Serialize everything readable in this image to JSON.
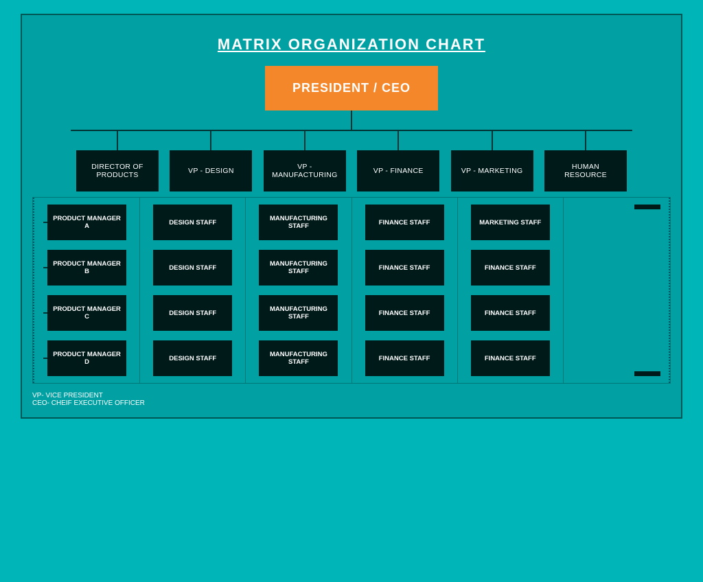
{
  "title": "MATRIX ORGANIZATION CHART",
  "ceo": {
    "label": "PRESIDENT / CEO"
  },
  "vps": [
    {
      "id": "dir-products",
      "label": "DIRECTOR OF PRODUCTS"
    },
    {
      "id": "vp-design",
      "label": "VP - DESIGN"
    },
    {
      "id": "vp-manufacturing",
      "label": "VP - MANUFACTURING"
    },
    {
      "id": "vp-finance",
      "label": "VP - FINANCE"
    },
    {
      "id": "vp-marketing",
      "label": "VP - MARKETING"
    },
    {
      "id": "human-resource",
      "label": "HUMAN RESOURCE"
    }
  ],
  "rows": [
    {
      "pm": "PRODUCT MANAGER A",
      "cols": [
        "DESIGN STAFF",
        "MANUFACTURING STAFF",
        "FINANCE STAFF",
        "MARKETING STAFF",
        ""
      ]
    },
    {
      "pm": "PRODUCT MANAGER B",
      "cols": [
        "DESIGN STAFF",
        "MANUFACTURING STAFF",
        "FINANCE STAFF",
        "FINANCE STAFF",
        ""
      ]
    },
    {
      "pm": "PRODUCT MANAGER C",
      "cols": [
        "DESIGN STAFF",
        "MANUFACTURING STAFF",
        "FINANCE STAFF",
        "FINANCE STAFF",
        ""
      ]
    },
    {
      "pm": "PRODUCT MANAGER D",
      "cols": [
        "DESIGN STAFF",
        "MANUFACTURING STAFF",
        "FINANCE STAFF",
        "FINANCE STAFF",
        ""
      ]
    }
  ],
  "legend": {
    "line1": "VP- VICE PRESIDENT",
    "line2": "CEO- CHEIF EXECUTIVE OFFICER"
  },
  "colors": {
    "background": "#00b5b8",
    "ceo_bg": "#f4872a",
    "dark_box": "#001a1a",
    "connector": "#003333",
    "border": "#007777"
  }
}
